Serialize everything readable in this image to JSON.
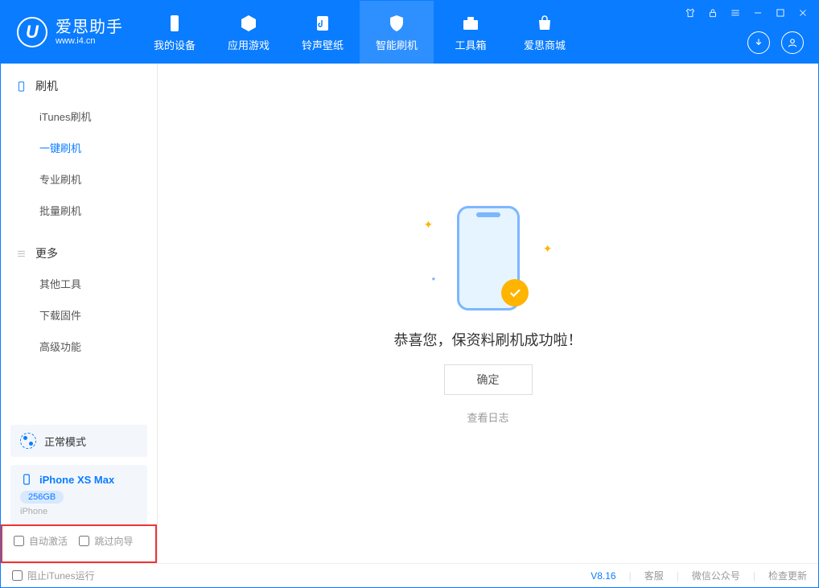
{
  "app": {
    "name_cn": "爱思助手",
    "url": "www.i4.cn",
    "logo_letter": "U"
  },
  "tabs": [
    {
      "label": "我的设备"
    },
    {
      "label": "应用游戏"
    },
    {
      "label": "铃声壁纸"
    },
    {
      "label": "智能刷机"
    },
    {
      "label": "工具箱"
    },
    {
      "label": "爱思商城"
    }
  ],
  "sidebar": {
    "section1": {
      "title": "刷机",
      "items": [
        {
          "label": "iTunes刷机"
        },
        {
          "label": "一键刷机"
        },
        {
          "label": "专业刷机"
        },
        {
          "label": "批量刷机"
        }
      ]
    },
    "section2": {
      "title": "更多",
      "items": [
        {
          "label": "其他工具"
        },
        {
          "label": "下载固件"
        },
        {
          "label": "高级功能"
        }
      ]
    },
    "mode": "正常模式",
    "device": {
      "name": "iPhone XS Max",
      "storage": "256GB",
      "type": "iPhone"
    },
    "checks": {
      "auto_activate": "自动激活",
      "skip_guide": "跳过向导"
    }
  },
  "main": {
    "success_text": "恭喜您，保资料刷机成功啦！",
    "ok_button": "确定",
    "log_link": "查看日志"
  },
  "footer": {
    "block_itunes": "阻止iTunes运行",
    "version": "V8.16",
    "links": {
      "service": "客服",
      "wechat": "微信公众号",
      "update": "检查更新"
    }
  }
}
